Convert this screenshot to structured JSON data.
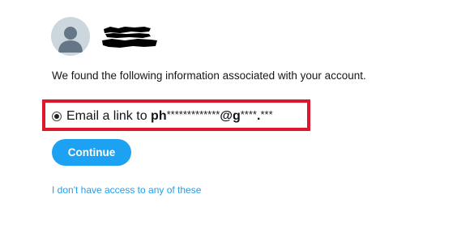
{
  "account": {
    "avatar_icon": "default-avatar-icon",
    "name_redacted": true
  },
  "message": "We found the following information associated with your account.",
  "option": {
    "selected": true,
    "prefix": "Email a link to ",
    "part1_bold": "ph",
    "part1_mask": "*************",
    "part2_bold": "@g",
    "part2_mask": "****",
    "part3_bold": ".",
    "part3_mask": "***"
  },
  "continue_label": "Continue",
  "no_access_link": "I don't have access to any of these",
  "colors": {
    "accent": "#1da1f2",
    "highlight": "#e0162b",
    "avatar_bg": "#ccd6dd",
    "avatar_fg": "#657786"
  }
}
